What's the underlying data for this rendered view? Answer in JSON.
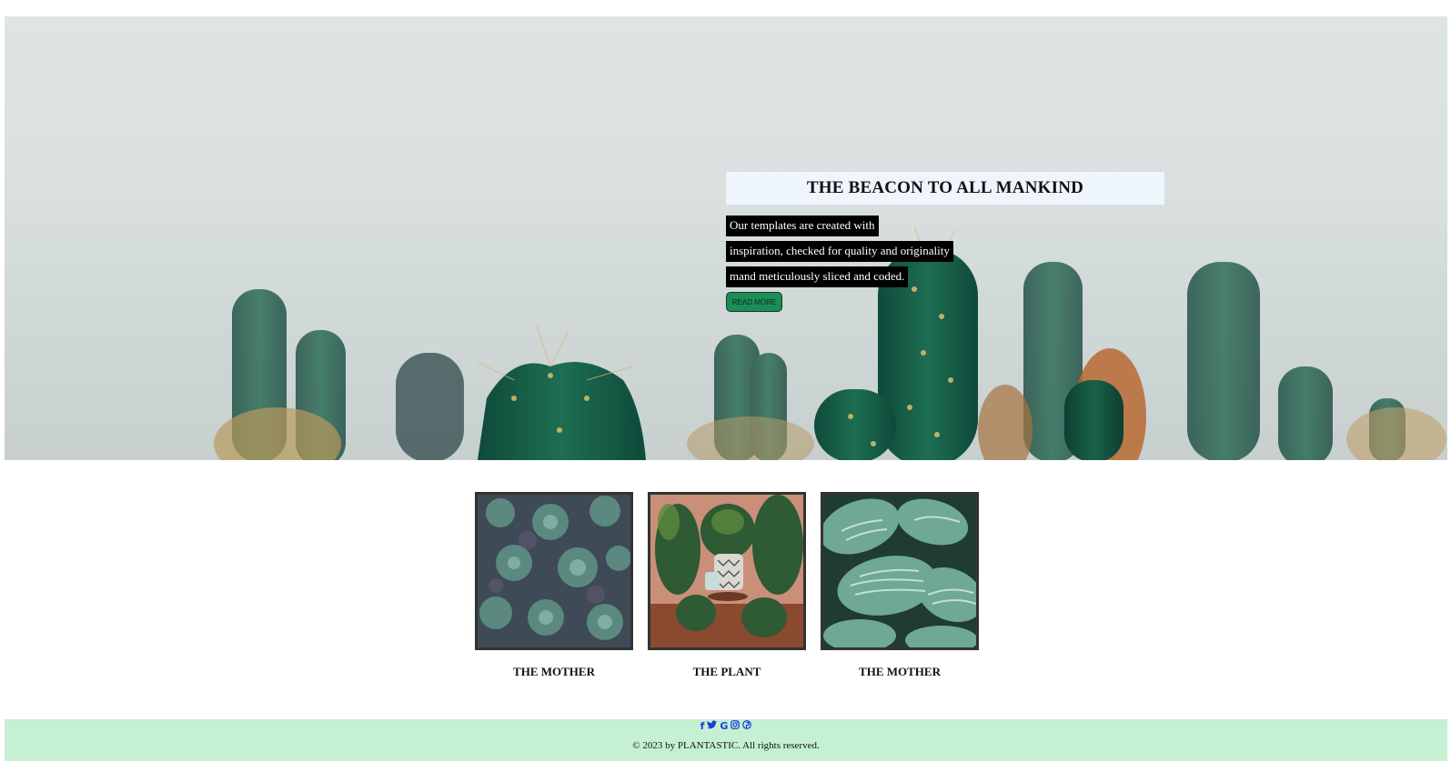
{
  "hero": {
    "title": "THE BEACON TO ALL MANKIND",
    "lines": [
      "Our templates are created with",
      "inspiration, checked for quality and originality",
      "mand meticulously sliced and coded."
    ],
    "button_label": "READ MORE",
    "button_color": "#1e8c58",
    "title_box_color": "#eef5fc"
  },
  "gallery": {
    "items": [
      {
        "caption": "THE MOTHER",
        "image": "succulents"
      },
      {
        "caption": "THE PLANT",
        "image": "potted-plants"
      },
      {
        "caption": "THE MOTHER",
        "image": "striped-leaves"
      }
    ]
  },
  "footer": {
    "social_icons": [
      {
        "name": "facebook-icon",
        "glyph": "f"
      },
      {
        "name": "twitter-icon",
        "glyph": "🐦"
      },
      {
        "name": "google-icon",
        "glyph": "G"
      },
      {
        "name": "instagram-icon",
        "glyph": "◎"
      },
      {
        "name": "pinterest-icon",
        "glyph": "℗"
      }
    ],
    "copyright": "© 2023 by PLANTASTIC. All rights reserved.",
    "background": "#c6f0d2"
  }
}
